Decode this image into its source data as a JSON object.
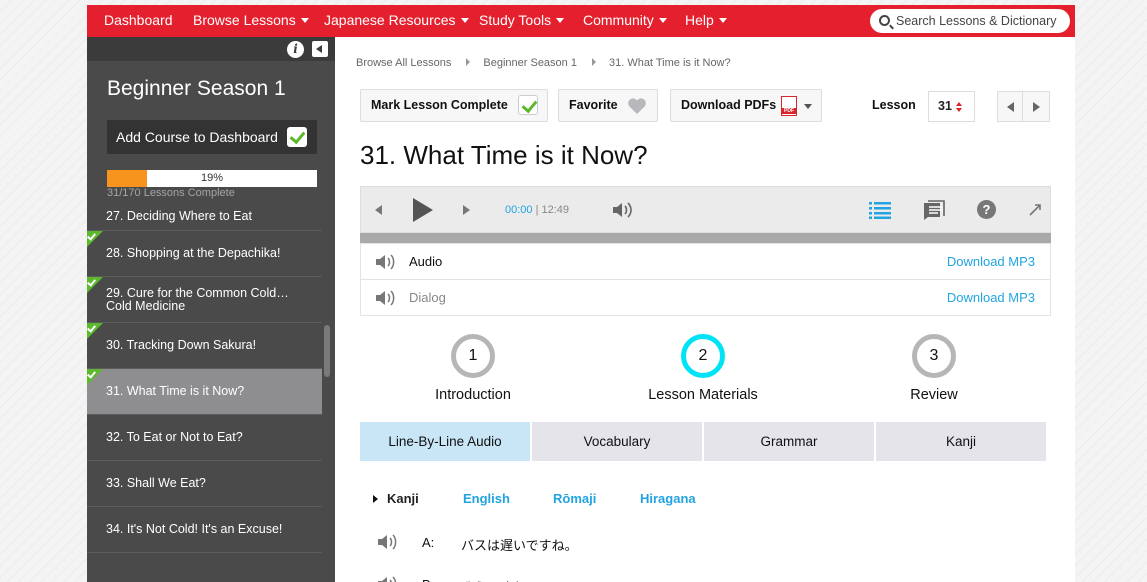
{
  "nav": {
    "items": [
      {
        "label": "Dashboard",
        "dropdown": false
      },
      {
        "label": "Browse Lessons",
        "dropdown": true
      },
      {
        "label": "Japanese Resources",
        "dropdown": true
      },
      {
        "label": "Study Tools",
        "dropdown": true
      },
      {
        "label": "Community",
        "dropdown": true
      },
      {
        "label": "Help",
        "dropdown": true
      }
    ],
    "search_placeholder": "Search Lessons & Dictionary"
  },
  "colors": {
    "brand": "#e5202e",
    "link": "#21a4e0",
    "progress": "#f7941d",
    "check": "#5cb82c",
    "active_step": "#00e3f6"
  },
  "sidebar": {
    "course_title": "Beginner Season 1",
    "add_course_label": "Add Course to Dashboard",
    "progress_label": "19%",
    "progress_value": 19,
    "progress_note": "31/170 Lessons Complete",
    "lessons": [
      {
        "title": "27. Deciding Where to Eat",
        "completed": false,
        "active": false
      },
      {
        "title": "28. Shopping at the Depachika!",
        "completed": true,
        "active": false
      },
      {
        "title": "29. Cure for the Common Cold…Cold Medicine",
        "completed": true,
        "active": false
      },
      {
        "title": "30. Tracking Down Sakura!",
        "completed": true,
        "active": false
      },
      {
        "title": "31. What Time is it Now?",
        "completed": true,
        "active": true
      },
      {
        "title": "32. To Eat or Not to Eat?",
        "completed": false,
        "active": false
      },
      {
        "title": "33. Shall We Eat?",
        "completed": false,
        "active": false
      },
      {
        "title": "34. It's Not Cold! It's an Excuse!",
        "completed": false,
        "active": false
      }
    ]
  },
  "breadcrumb": [
    "Browse All Lessons",
    "Beginner Season 1",
    "31. What Time is it Now?"
  ],
  "toolbar": {
    "mark_complete": "Mark Lesson Complete",
    "favorite": "Favorite",
    "download_pdfs": "Download PDFs",
    "lesson_label": "Lesson",
    "lesson_number": "31"
  },
  "title": "31. What Time is it Now?",
  "player": {
    "current_time": "00:00",
    "duration": "12:49"
  },
  "audio_rows": [
    {
      "label": "Audio",
      "download": "Download MP3"
    },
    {
      "label": "Dialog",
      "download": "Download MP3"
    }
  ],
  "steps": [
    {
      "number": "1",
      "label": "Introduction",
      "active": false
    },
    {
      "number": "2",
      "label": "Lesson Materials",
      "active": true
    },
    {
      "number": "3",
      "label": "Review",
      "active": false
    }
  ],
  "tabs": [
    "Line-By-Line Audio",
    "Vocabulary",
    "Grammar",
    "Kanji"
  ],
  "script_options": [
    "Kanji",
    "English",
    "Rōmaji",
    "Hiragana"
  ],
  "dialog_lines": [
    {
      "speaker": "A:",
      "text": "バスは遅いですね。"
    },
    {
      "speaker": "B:",
      "text": "そうですね。"
    }
  ]
}
